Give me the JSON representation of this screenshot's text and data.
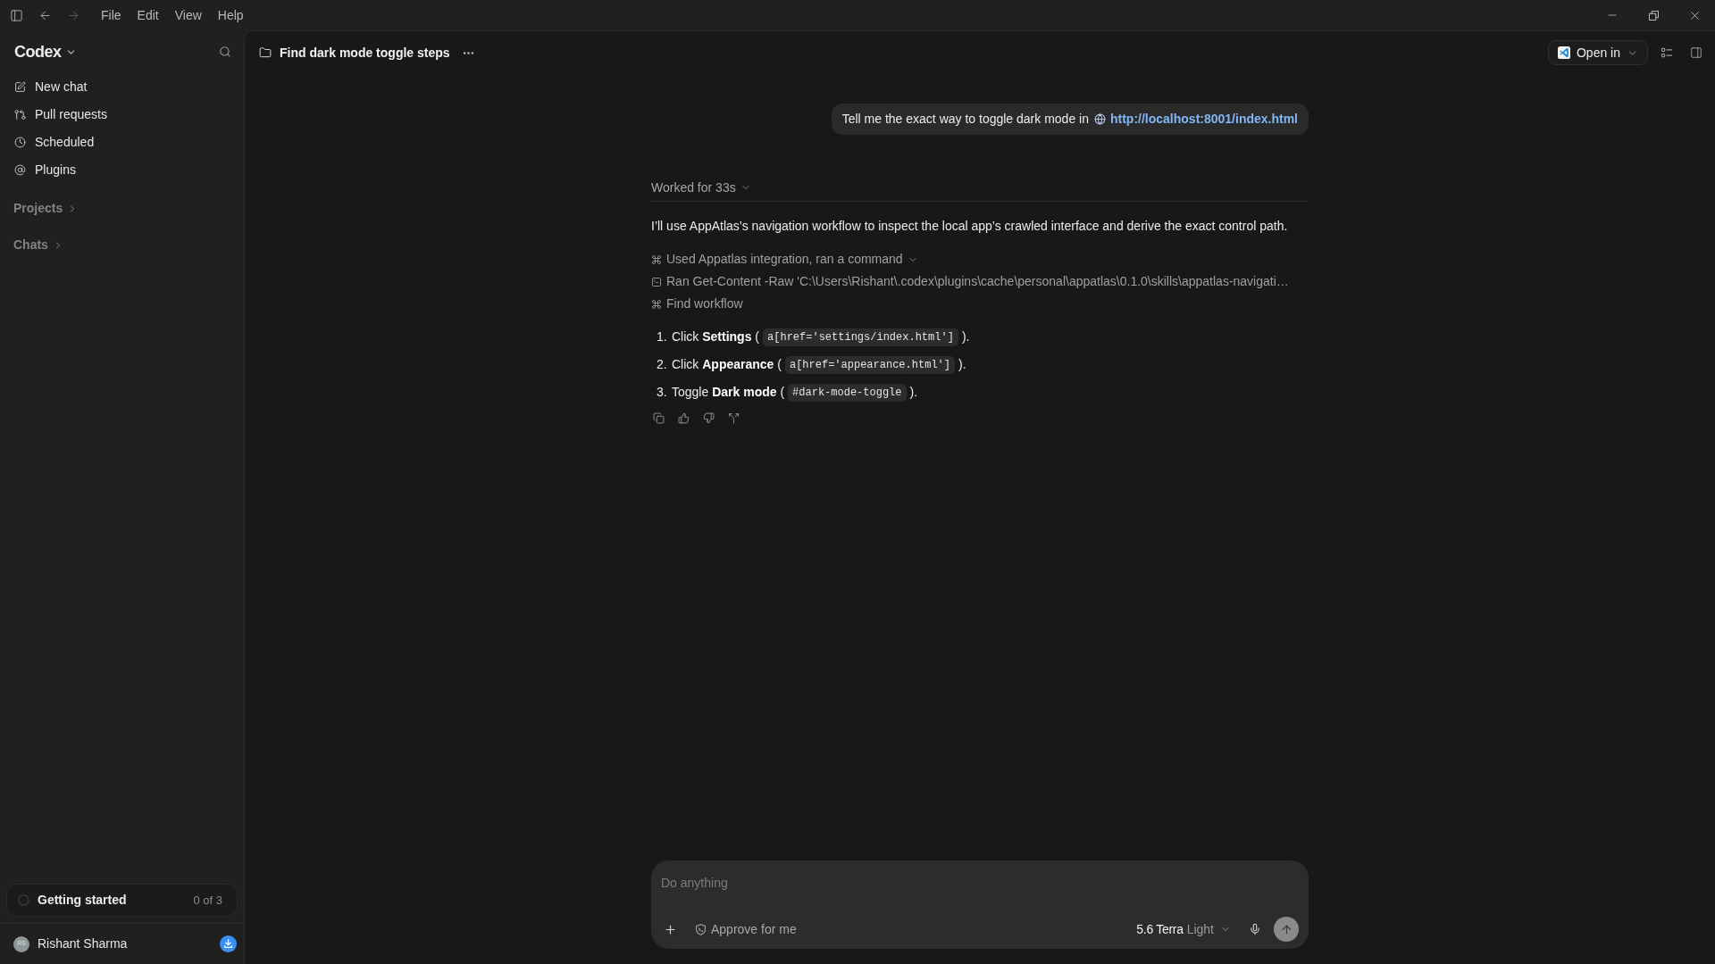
{
  "title_bar": {
    "navigation": [
      {
        "kind": "back",
        "disabled": false
      },
      {
        "kind": "forward",
        "disabled": true
      }
    ],
    "menu": [
      "File",
      "Edit",
      "View",
      "Help"
    ]
  },
  "sidebar": {
    "brand": "Codex",
    "nav": [
      {
        "label": "New chat"
      },
      {
        "label": "Pull requests"
      },
      {
        "label": "Scheduled"
      },
      {
        "label": "Plugins"
      }
    ],
    "sections": [
      {
        "label": "Projects",
        "expanded": false
      },
      {
        "label": "Chats",
        "expanded": false
      }
    ],
    "onboarding": {
      "label": "Getting started",
      "progress": "0 of 3"
    },
    "user": {
      "initials": "RS",
      "name": "Rishant Sharma"
    }
  },
  "header": {
    "title": "Find dark mode toggle steps",
    "open_in": "Open in"
  },
  "conversation": {
    "user_message": {
      "text": "Tell me the exact way to toggle dark mode in",
      "link": "http://localhost:8001/index.html"
    },
    "status": "Worked for 33s",
    "intro": "I’ll use AppAtlas’s navigation workflow to inspect the local app’s crawled interface and derive the exact control path.",
    "activity": {
      "summary": "Used Appatlas integration, ran a command",
      "items": [
        {
          "kind": "command",
          "text": "Ran Get-Content -Raw 'C:\\Users\\Rishant\\.codex\\plugins\\cache\\personal\\appatlas\\0.1.0\\skills\\appatlas-navigati…"
        },
        {
          "kind": "workflow",
          "text": "Find workflow"
        }
      ]
    },
    "steps": [
      {
        "number": "1.",
        "text": "Click **Settings** (",
        "code": "a[href='settings/index.html']",
        "end": ")."
      },
      {
        "number": "2.",
        "text": "Click **Appearance** (",
        "code": "a[href='appearance.html']",
        "end": ")."
      },
      {
        "number": "3.",
        "text": "Toggle **Dark mode** (",
        "code": "#dark-mode-toggle",
        "end": ")."
      }
    ]
  },
  "composer": {
    "placeholder": "Do anything",
    "approval": "Approve for me",
    "model": "5.6 Terra",
    "effort": "Light",
    "send_disabled": true
  }
}
